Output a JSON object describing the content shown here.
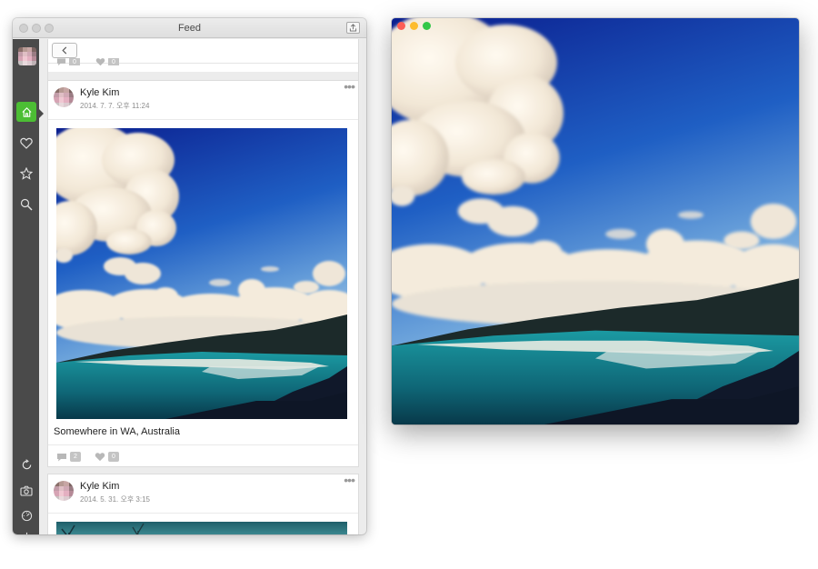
{
  "window": {
    "title": "Feed"
  },
  "sidebar": {
    "items": [
      {
        "name": "home-icon",
        "active": true
      },
      {
        "name": "heart-icon"
      },
      {
        "name": "star-icon"
      },
      {
        "name": "search-icon"
      },
      {
        "name": "refresh-icon"
      },
      {
        "name": "camera-icon"
      },
      {
        "name": "dashboard-icon"
      },
      {
        "name": "power-icon"
      }
    ],
    "accent": "#4cbe34"
  },
  "posts": [
    {
      "author": "Kyle Kim",
      "date": "2014. 7. 7. 오후 11:24",
      "caption": "Somewhere in WA, Australia",
      "comments": "2",
      "likes": "0"
    },
    {
      "author": "Kyle Kim",
      "date": "2014. 5. 31. 오후 3:15"
    }
  ],
  "previous_post": {
    "comments": "0",
    "likes": "0"
  },
  "preview": {
    "dots": [
      "#fc5f57",
      "#fdbc2e",
      "#33c748"
    ]
  }
}
